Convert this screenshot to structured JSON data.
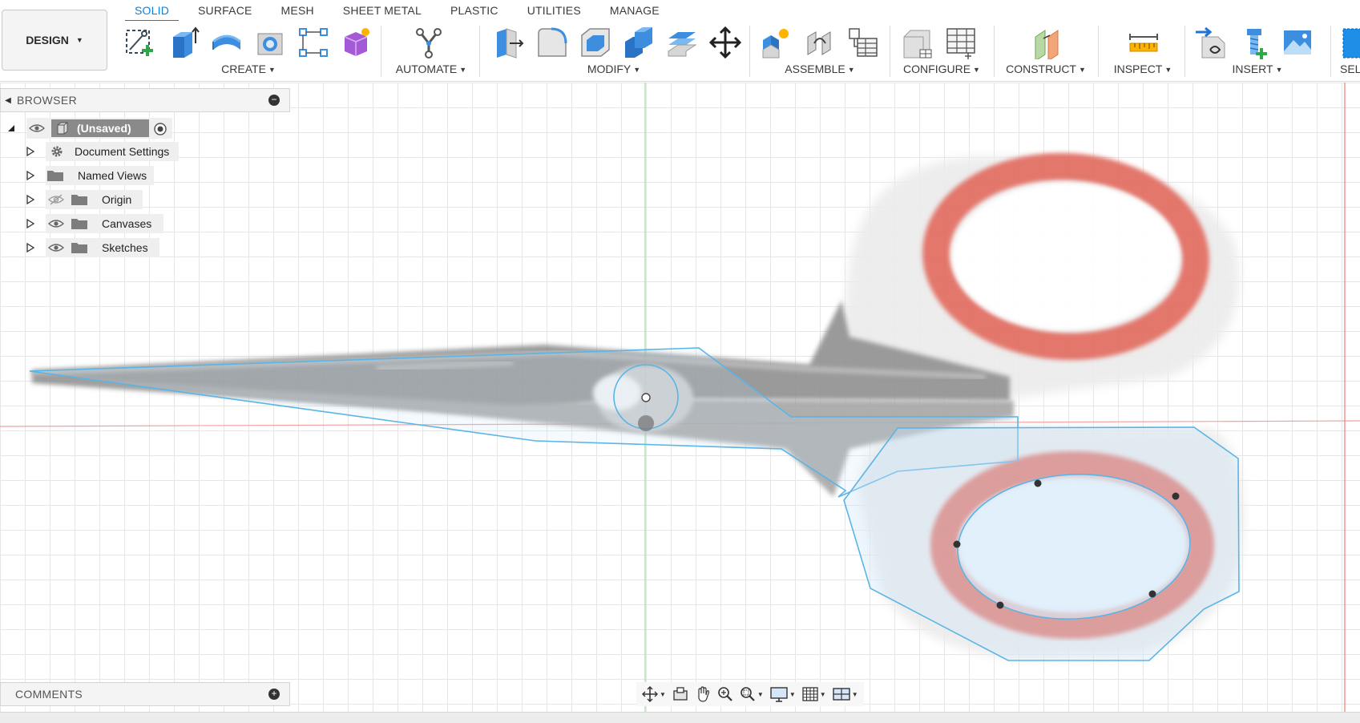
{
  "tabs": [
    {
      "label": "SOLID",
      "active": true
    },
    {
      "label": "SURFACE",
      "active": false
    },
    {
      "label": "MESH",
      "active": false
    },
    {
      "label": "SHEET METAL",
      "active": false
    },
    {
      "label": "PLASTIC",
      "active": false
    },
    {
      "label": "UTILITIES",
      "active": false
    },
    {
      "label": "MANAGE",
      "active": false
    }
  ],
  "toolbar": {
    "design_label": "DESIGN",
    "groups": [
      {
        "label": "CREATE",
        "icons": [
          "create-sketch-icon",
          "extrude-icon",
          "revolve-icon",
          "hole-icon",
          "rectangular-pattern-icon",
          "create-form-icon"
        ]
      },
      {
        "label": "AUTOMATE",
        "icons": [
          "automate-icon"
        ]
      },
      {
        "label": "MODIFY",
        "icons": [
          "press-pull-icon",
          "fillet-icon",
          "shell-icon",
          "combine-icon",
          "offset-face-icon",
          "move-icon"
        ]
      },
      {
        "label": "ASSEMBLE",
        "icons": [
          "new-component-icon",
          "joint-icon",
          "table-icon"
        ]
      },
      {
        "label": "CONFIGURE",
        "icons": [
          "configure-icon",
          "configure-table-icon"
        ]
      },
      {
        "label": "CONSTRUCT",
        "icons": [
          "offset-plane-icon"
        ]
      },
      {
        "label": "INSPECT",
        "icons": [
          "measure-icon"
        ]
      },
      {
        "label": "INSERT",
        "icons": [
          "insert-derive-icon",
          "insert-mcmaster-icon",
          "canvas-image-icon"
        ]
      },
      {
        "label": "SELI",
        "icons": [
          "select-icon"
        ]
      }
    ]
  },
  "browser": {
    "title": "BROWSER",
    "root": "(Unsaved)",
    "items": [
      {
        "label": "Document Settings",
        "icon": "gear-icon",
        "eye": "none"
      },
      {
        "label": "Named Views",
        "icon": "folder-icon",
        "eye": "none"
      },
      {
        "label": "Origin",
        "icon": "folder-icon",
        "eye": "hidden"
      },
      {
        "label": "Canvases",
        "icon": "folder-icon",
        "eye": "visible"
      },
      {
        "label": "Sketches",
        "icon": "folder-icon",
        "eye": "visible"
      }
    ]
  },
  "comments": {
    "title": "COMMENTS"
  },
  "navbar": {
    "buttons": [
      "orbit-icon",
      "look-at-icon",
      "pan-icon",
      "zoom-icon",
      "zoom-window-icon",
      "display-settings-icon",
      "grid-settings-icon",
      "viewports-icon"
    ]
  },
  "colors": {
    "accent": "#0a7fe0",
    "sketch_line": "#5ab4e6",
    "handle_red": "#e0675c",
    "blade_gray": "#9a9a9a",
    "axis_red": "#f07a7a",
    "axis_green": "#7ed87e"
  },
  "canvas_image": {
    "subject": "scissors-canvas-icon"
  }
}
